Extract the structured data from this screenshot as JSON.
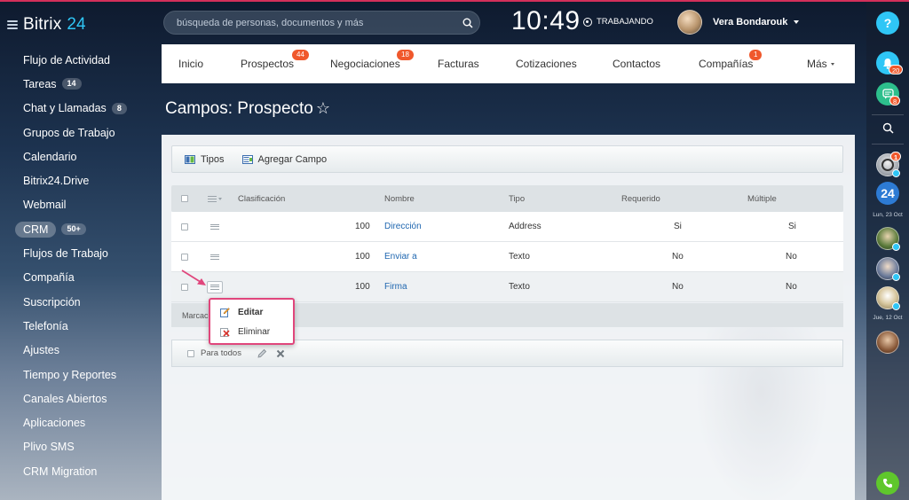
{
  "app": {
    "name": "Bitrix",
    "name_num": "24"
  },
  "search": {
    "placeholder": "búsqueda de personas, documentos y más"
  },
  "clock": "10:49",
  "status": "TRABAJANDO",
  "user": {
    "name": "Vera Bondarouk"
  },
  "sidebar": {
    "items": [
      {
        "label": "Flujo de Actividad"
      },
      {
        "label": "Tareas",
        "counter": "14"
      },
      {
        "label": "Chat y Llamadas",
        "counter": "8"
      },
      {
        "label": "Grupos de Trabajo"
      },
      {
        "label": "Calendario"
      },
      {
        "label": "Bitrix24.Drive"
      },
      {
        "label": "Webmail"
      },
      {
        "label": "CRM",
        "counter": "50+",
        "active": true
      },
      {
        "label": "Flujos de Trabajo"
      },
      {
        "label": "Compañía"
      },
      {
        "label": "Suscripción"
      },
      {
        "label": "Telefonía"
      },
      {
        "label": "Ajustes"
      },
      {
        "label": "Tiempo y Reportes"
      },
      {
        "label": "Canales Abiertos"
      },
      {
        "label": "Aplicaciones"
      },
      {
        "label": "Plivo SMS"
      },
      {
        "label": "CRM Migration"
      }
    ]
  },
  "tabs": [
    {
      "label": "Inicio"
    },
    {
      "label": "Prospectos",
      "badge": "44"
    },
    {
      "label": "Negociaciones",
      "badge": "18"
    },
    {
      "label": "Facturas"
    },
    {
      "label": "Cotizaciones"
    },
    {
      "label": "Contactos"
    },
    {
      "label": "Compañías",
      "badge": "1"
    },
    {
      "label": "Más"
    }
  ],
  "page": {
    "title": "Campos: Prospecto",
    "star": "☆"
  },
  "toolbar": {
    "tipos": "Tipos",
    "agregar": "Agregar Campo"
  },
  "grid": {
    "columns": {
      "clasificacion": "Clasificación",
      "nombre": "Nombre",
      "tipo": "Tipo",
      "requerido": "Requerido",
      "multiple": "Múltiple"
    },
    "rows": [
      {
        "sort": "100",
        "name": "Dirección",
        "type": "Address",
        "required": "Si",
        "multiple": "Si"
      },
      {
        "sort": "100",
        "name": "Enviar a",
        "type": "Texto",
        "required": "No",
        "multiple": "No"
      },
      {
        "sort": "100",
        "name": "Firma",
        "type": "Texto",
        "required": "No",
        "multiple": "No"
      }
    ],
    "footer": "Marcados: 0",
    "footer_visible": "Marcac"
  },
  "actions": {
    "for_all": "Para todos"
  },
  "popup": {
    "edit": "Editar",
    "delete": "Eliminar"
  },
  "rail": {
    "help": "?",
    "notifications_count": "20",
    "chat_count": "8",
    "avatar1_count": "1",
    "b24_label": "24",
    "date1": "Lun, 23 Oct",
    "date2": "Jue, 12 Oct"
  },
  "colors": {
    "accent": "#2fc6f6",
    "badge": "#f0582c",
    "highlight": "#e0467c",
    "link": "#2067b0"
  }
}
